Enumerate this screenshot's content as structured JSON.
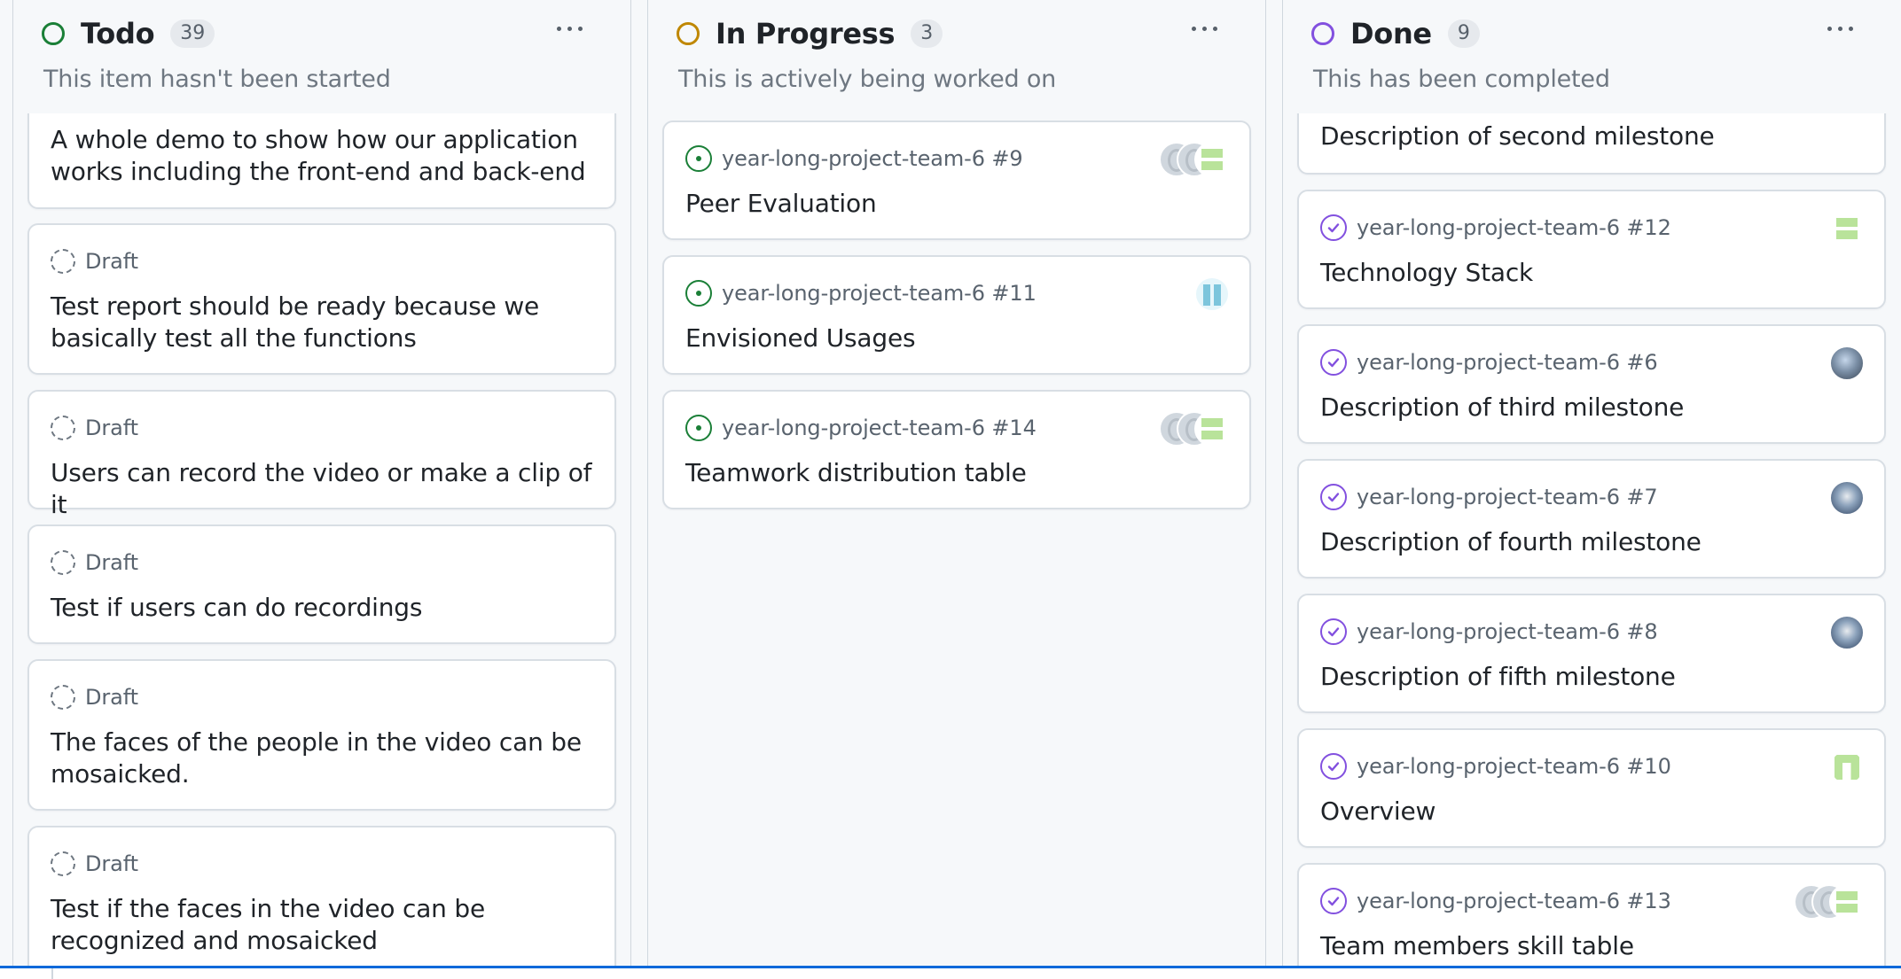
{
  "colors": {
    "todo_status": "#1a7f37",
    "in_progress_status": "#bf8700",
    "done_status": "#8250df",
    "open_issue": "#1a7f37",
    "closed_issue": "#8250df"
  },
  "columns": [
    {
      "title": "Todo",
      "count": "39",
      "description": "This item hasn't been started",
      "cards": [
        {
          "kind": "body",
          "title": "A whole demo to show how our application works including the front-end and back-end"
        },
        {
          "kind": "draft",
          "meta": "Draft",
          "icon": "draft-icon",
          "title": "Test report should be ready because we basically test all the functions"
        },
        {
          "kind": "draft",
          "meta": "Draft",
          "icon": "draft-icon",
          "title": "Users can record the video or make a clip of it"
        },
        {
          "kind": "draft",
          "meta": "Draft",
          "icon": "draft-icon",
          "title": "Test if users can do recordings"
        },
        {
          "kind": "draft",
          "meta": "Draft",
          "icon": "draft-icon",
          "title": "The faces of the people in the video can be mosaicked."
        },
        {
          "kind": "draft",
          "meta": "Draft",
          "icon": "draft-icon",
          "title": "Test if the faces in the video can be recognized and mosaicked"
        }
      ]
    },
    {
      "title": "In Progress",
      "count": "3",
      "description": "This is actively being worked on",
      "cards": [
        {
          "kind": "issue",
          "meta": "year-long-project-team-6 #9",
          "icon": "open-issue-icon",
          "title": "Peer Evaluation"
        },
        {
          "kind": "issue",
          "meta": "year-long-project-team-6 #11",
          "icon": "open-issue-icon",
          "title": "Envisioned Usages"
        },
        {
          "kind": "issue",
          "meta": "year-long-project-team-6 #14",
          "icon": "open-issue-icon",
          "title": "Teamwork distribution table"
        }
      ]
    },
    {
      "title": "Done",
      "count": "9",
      "description": "This has been completed",
      "cards": [
        {
          "kind": "body",
          "title": "Description of second milestone"
        },
        {
          "kind": "issue",
          "meta": "year-long-project-team-6 #12",
          "icon": "closed-issue-icon",
          "title": "Technology Stack"
        },
        {
          "kind": "issue",
          "meta": "year-long-project-team-6 #6",
          "icon": "closed-issue-icon",
          "title": "Description of third milestone"
        },
        {
          "kind": "issue",
          "meta": "year-long-project-team-6 #7",
          "icon": "closed-issue-icon",
          "title": "Description of fourth milestone"
        },
        {
          "kind": "issue",
          "meta": "year-long-project-team-6 #8",
          "icon": "closed-issue-icon",
          "title": "Description of fifth milestone"
        },
        {
          "kind": "issue",
          "meta": "year-long-project-team-6 #10",
          "icon": "closed-issue-icon",
          "title": "Overview"
        },
        {
          "kind": "issue",
          "meta": "year-long-project-team-6 #13",
          "icon": "closed-issue-icon",
          "title": "Team members skill table"
        }
      ]
    }
  ]
}
